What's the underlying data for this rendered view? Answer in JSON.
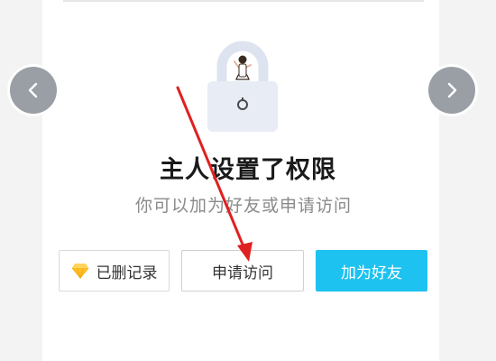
{
  "title": "主人设置了权限",
  "subtitle": "你可以加为好友或申请访问",
  "buttons": {
    "deleted_records": "已删记录",
    "request_access": "申请访问",
    "add_friend": "加为好友"
  },
  "icons": {
    "prev": "chevron-left-icon",
    "next": "chevron-right-icon",
    "gem": "gem-icon",
    "lock": "lock-illustration"
  },
  "colors": {
    "accent": "#1ec2f0",
    "annotation_arrow": "#e02020"
  }
}
